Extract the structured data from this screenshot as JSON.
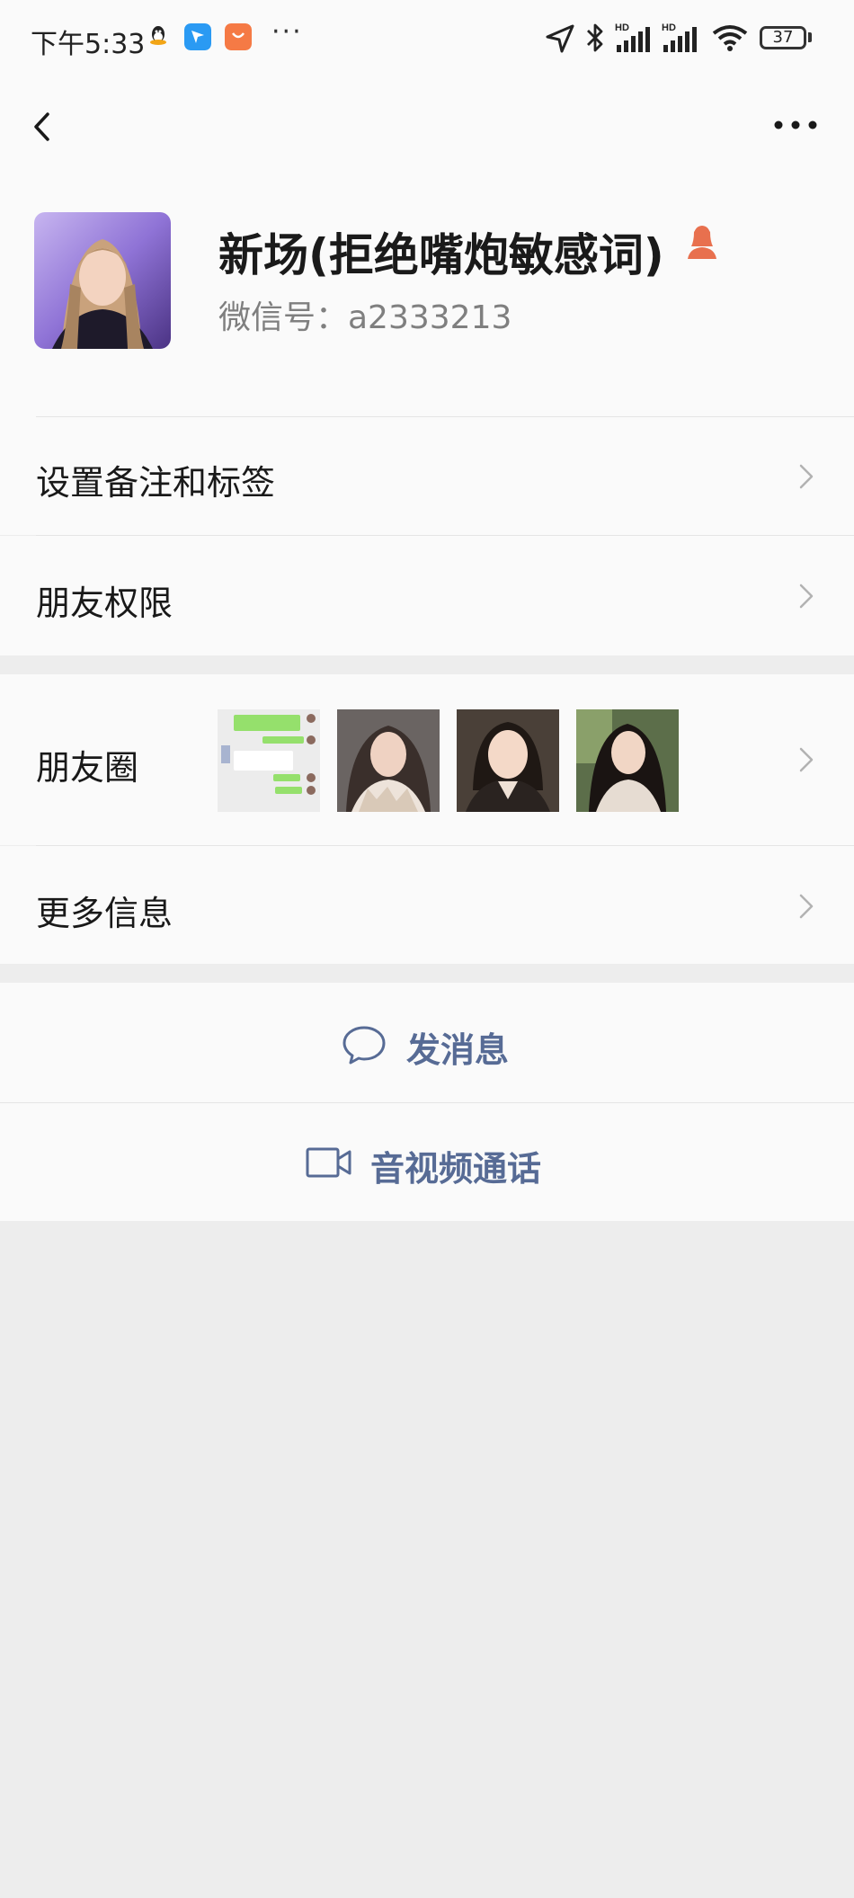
{
  "status_bar": {
    "time": "下午5:33",
    "more": "···",
    "battery": "37",
    "icons": [
      "qq-icon",
      "messenger-app-icon",
      "store-app-icon",
      "location-icon",
      "bluetooth-icon",
      "signal-icon",
      "signal-icon",
      "wifi-icon",
      "battery-icon"
    ]
  },
  "nav": {
    "back_icon": "chevron-left-icon",
    "more_icon": "more-horizontal-icon"
  },
  "profile": {
    "nickname": "新场(拒绝嘴炮敏感词)",
    "wechat_id": "微信号：a2333213",
    "gender_icon": "female-icon"
  },
  "menu": {
    "remark_label": "设置备注和标签",
    "permission_label": "朋友权限",
    "moments_label": "朋友圈",
    "more_info_label": "更多信息"
  },
  "actions": {
    "message_label": "发消息",
    "call_label": "音视频通话"
  },
  "colors": {
    "link": "#576b95",
    "background": "#ededed",
    "card": "#fafafa",
    "gender": "#e8704e"
  }
}
